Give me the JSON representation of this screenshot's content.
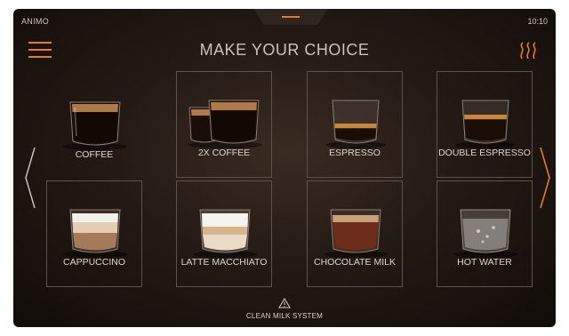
{
  "header": {
    "brand": "ANIMO",
    "time": "10:10",
    "title": "MAKE YOUR CHOICE"
  },
  "icons": {
    "menu": "hamburger-menu-icon",
    "heat": "heat-waves-icon",
    "prev": "chevron-left-icon",
    "next": "chevron-right-icon",
    "warning": "warning-triangle-icon"
  },
  "drinks": [
    {
      "label": "COFFEE"
    },
    {
      "label": "2X COFFEE"
    },
    {
      "label": "ESPRESSO"
    },
    {
      "label": "DOUBLE ESPRESSO"
    },
    {
      "label": "CAPPUCCINO"
    },
    {
      "label": "LATTE MACCHIATO"
    },
    {
      "label": "CHOCOLATE MILK"
    },
    {
      "label": "HOT WATER"
    }
  ],
  "notice": {
    "text": "CLEAN MILK SYSTEM"
  },
  "progress": 0.34,
  "colors": {
    "accent": "#e47a2e",
    "text": "#ddd6cf",
    "tile_border": "#5e534b"
  }
}
